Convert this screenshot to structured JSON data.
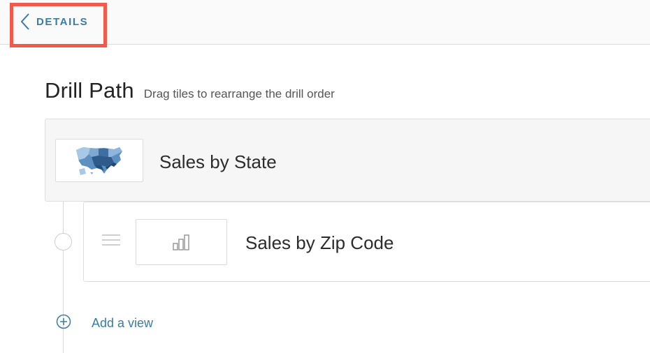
{
  "header": {
    "back_label": "DETAILS",
    "back_icon": "chevron-left-icon",
    "highlight_color": "#f15a4a"
  },
  "drill_path": {
    "title": "Drill Path",
    "subtitle": "Drag tiles to rearrange the drill order",
    "tiles": [
      {
        "title": "Sales by State",
        "thumbnail": "us-map-icon"
      },
      {
        "title": "Sales by Zip Code",
        "thumbnail": "bar-chart-icon"
      }
    ]
  },
  "add_view": {
    "label": "Add a view",
    "icon": "plus-circle-icon"
  },
  "colors": {
    "accent": "#3a7ca5",
    "tile_bg": "#f6f6f6",
    "border": "#dedede"
  }
}
